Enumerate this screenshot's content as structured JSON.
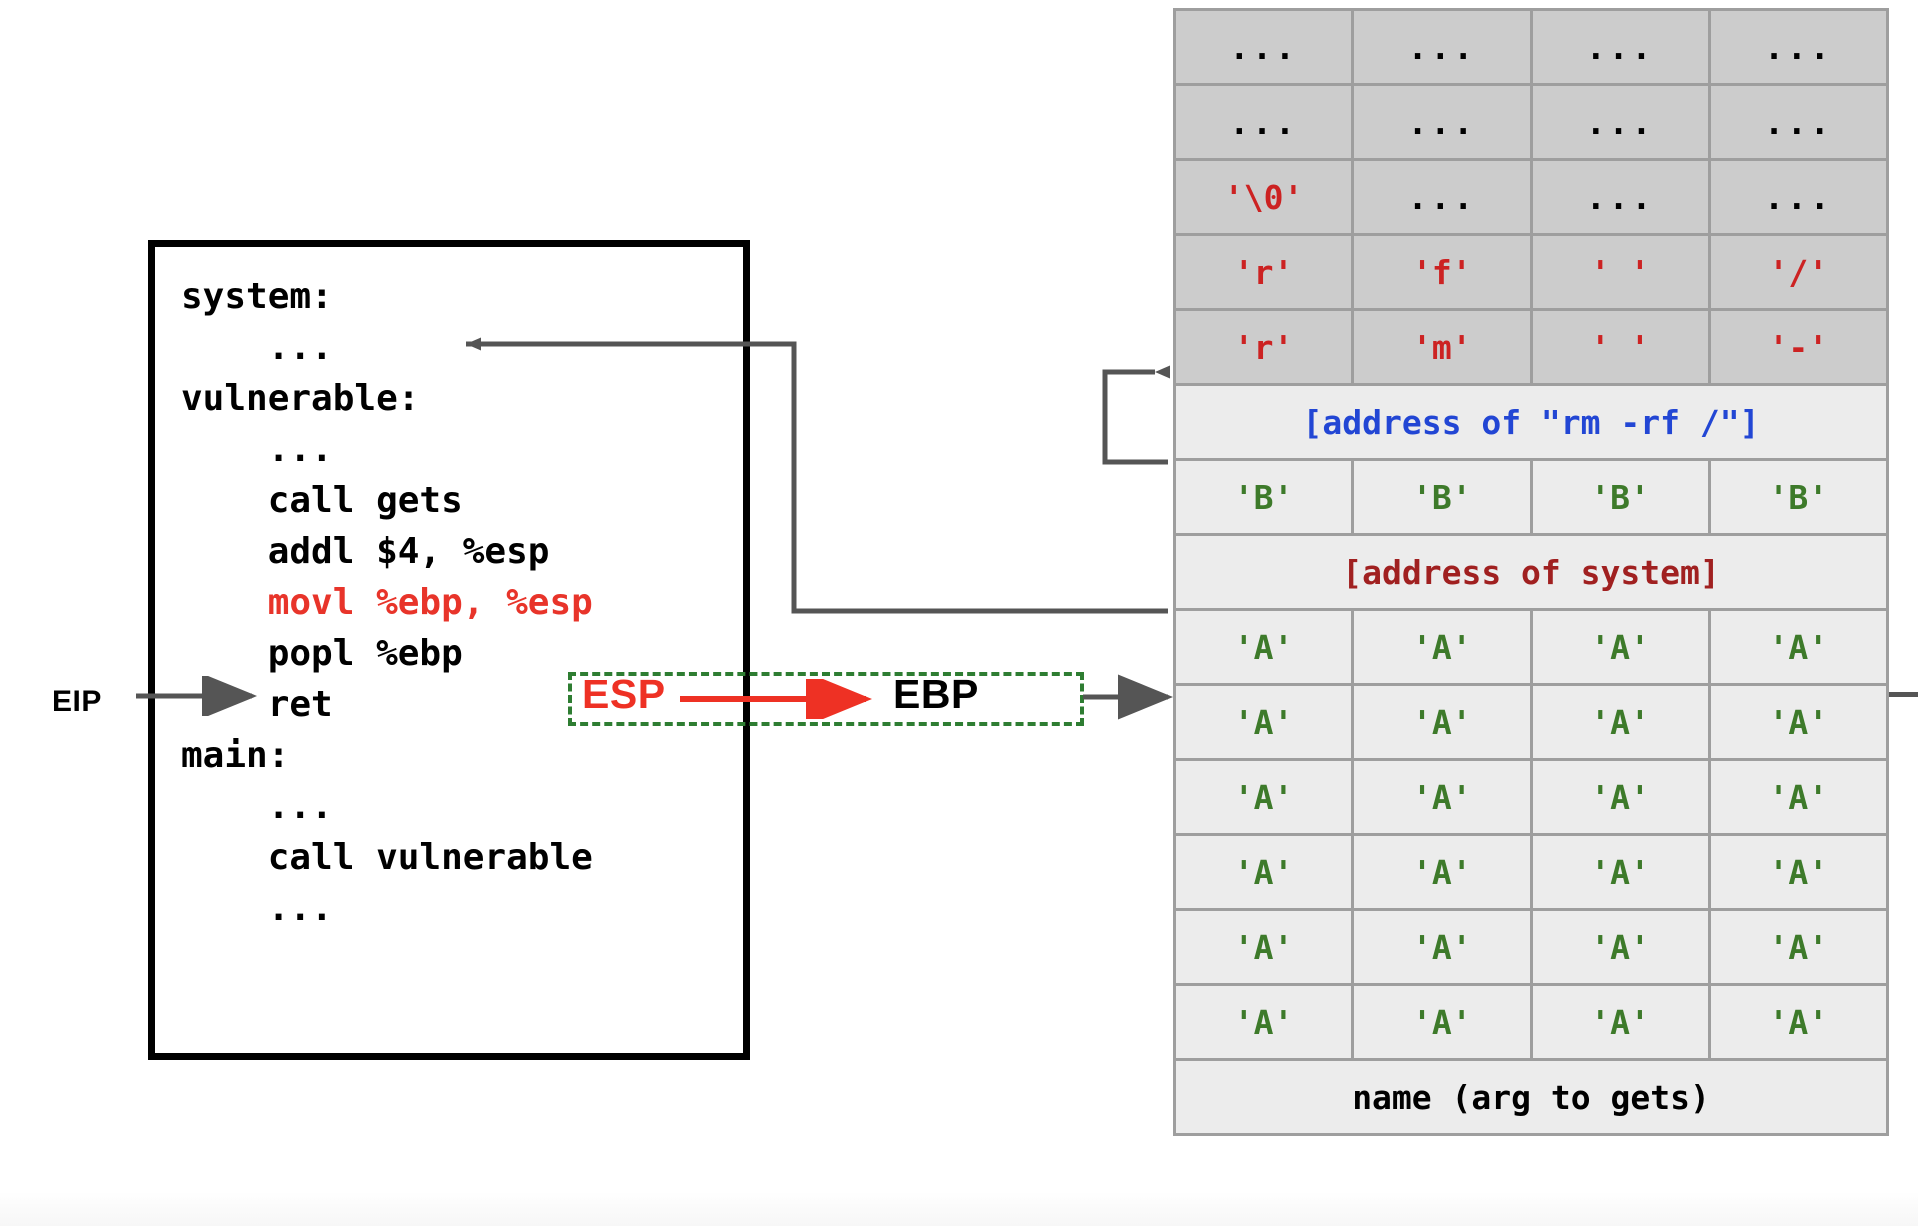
{
  "code_box": {
    "lines": [
      {
        "text": "system:",
        "color": "black"
      },
      {
        "text": "    ...",
        "color": "black"
      },
      {
        "text": "",
        "color": "black"
      },
      {
        "text": "vulnerable:",
        "color": "black"
      },
      {
        "text": "    ...",
        "color": "black"
      },
      {
        "text": "    call gets",
        "color": "black"
      },
      {
        "text": "    addl $4, %esp",
        "color": "black"
      },
      {
        "text": "    movl %ebp, %esp",
        "color": "red"
      },
      {
        "text": "    popl %ebp",
        "color": "black"
      },
      {
        "text": "    ret",
        "color": "black"
      },
      {
        "text": "",
        "color": "black"
      },
      {
        "text": "main:",
        "color": "black"
      },
      {
        "text": "    ...",
        "color": "black"
      },
      {
        "text": "    call vulnerable",
        "color": "black"
      },
      {
        "text": "    ...",
        "color": "black"
      }
    ]
  },
  "registers": {
    "eip_label": "EIP",
    "esp_label": "ESP",
    "ebp_label": "EBP"
  },
  "colors": {
    "red_code": "#e8342a",
    "esp_red": "#ee3124",
    "dashed_green": "#2e7d32",
    "char_red": "#cc2222",
    "char_green": "#3d7a2a",
    "addr_blue": "#2246d4",
    "addr_darkred": "#a02020",
    "cell_upper": "#cccccc",
    "cell_lower": "#ececec",
    "border_gray": "#9e9e9e",
    "arrow_gray": "#555555"
  },
  "stack": {
    "rows": [
      {
        "type": "cells",
        "zone": "upper",
        "style": "dots",
        "cells": [
          "...",
          "...",
          "...",
          "..."
        ]
      },
      {
        "type": "cells",
        "zone": "upper",
        "style": "dots",
        "cells": [
          "...",
          "...",
          "...",
          "..."
        ]
      },
      {
        "type": "cells",
        "zone": "upper",
        "style": "mixed",
        "cells": [
          "'\\0'",
          "...",
          "...",
          "..."
        ],
        "cell_styles": [
          "chr-red",
          "dots",
          "dots",
          "dots"
        ]
      },
      {
        "type": "cells",
        "zone": "upper",
        "style": "chr-red",
        "cells": [
          "'r'",
          "'f'",
          "' '",
          "'/'"
        ]
      },
      {
        "type": "cells",
        "zone": "upper",
        "style": "chr-red",
        "cells": [
          "'r'",
          "'m'",
          "' '",
          "'-'"
        ]
      },
      {
        "type": "span",
        "zone": "lower",
        "style": "addr-blue",
        "label": "[address of \"rm -rf /\"]"
      },
      {
        "type": "cells",
        "zone": "lower",
        "style": "chr-green",
        "cells": [
          "'B'",
          "'B'",
          "'B'",
          "'B'"
        ]
      },
      {
        "type": "span",
        "zone": "lower",
        "style": "addr-darkred",
        "label": "[address of system]"
      },
      {
        "type": "cells",
        "zone": "lower",
        "style": "chr-green",
        "cells": [
          "'A'",
          "'A'",
          "'A'",
          "'A'"
        ]
      },
      {
        "type": "cells",
        "zone": "lower",
        "style": "chr-green",
        "cells": [
          "'A'",
          "'A'",
          "'A'",
          "'A'"
        ]
      },
      {
        "type": "cells",
        "zone": "lower",
        "style": "chr-green",
        "cells": [
          "'A'",
          "'A'",
          "'A'",
          "'A'"
        ]
      },
      {
        "type": "cells",
        "zone": "lower",
        "style": "chr-green",
        "cells": [
          "'A'",
          "'A'",
          "'A'",
          "'A'"
        ]
      },
      {
        "type": "cells",
        "zone": "lower",
        "style": "chr-green",
        "cells": [
          "'A'",
          "'A'",
          "'A'",
          "'A'"
        ]
      },
      {
        "type": "cells",
        "zone": "lower",
        "style": "chr-green",
        "cells": [
          "'A'",
          "'A'",
          "'A'",
          "'A'"
        ]
      },
      {
        "type": "span",
        "zone": "lower",
        "style": "footer-label",
        "label": "name (arg to gets)"
      }
    ]
  }
}
